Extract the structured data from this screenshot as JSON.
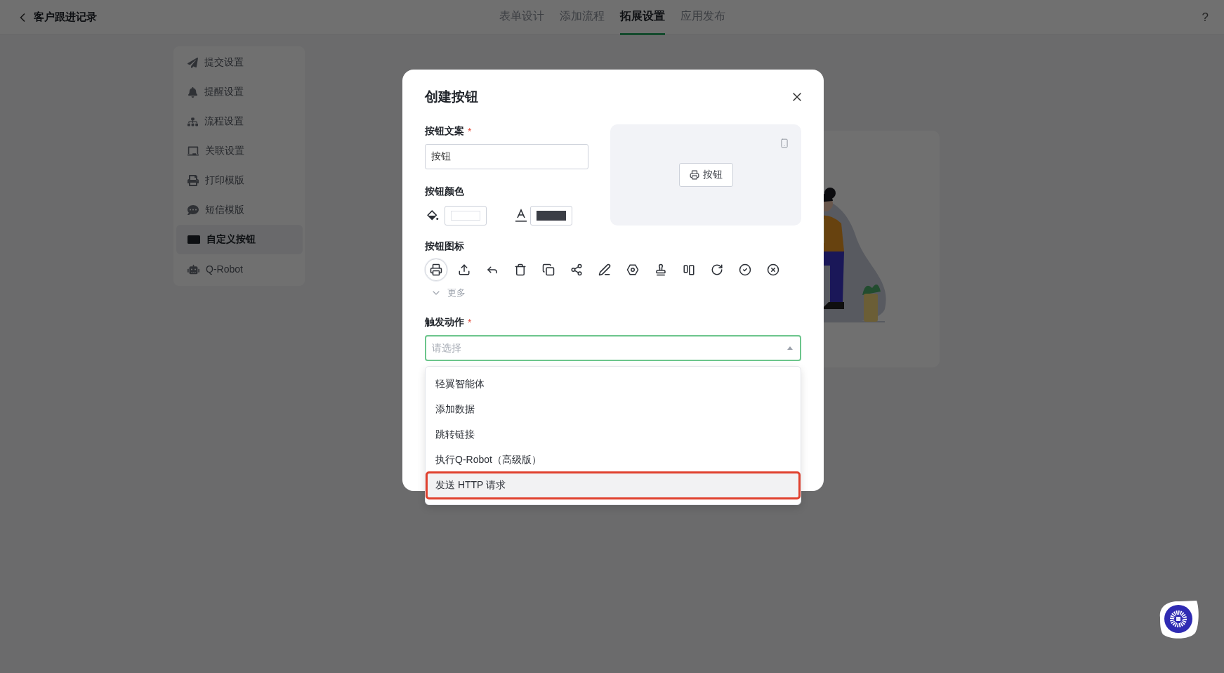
{
  "header": {
    "title": "客户跟进记录",
    "help": "?",
    "tabs": [
      {
        "label": "表单设计",
        "selected": false
      },
      {
        "label": "添加流程",
        "selected": false
      },
      {
        "label": "拓展设置",
        "selected": true
      },
      {
        "label": "应用发布",
        "selected": false
      }
    ]
  },
  "sidebar": {
    "items": [
      {
        "label": "提交设置",
        "selected": false
      },
      {
        "label": "提醒设置",
        "selected": false
      },
      {
        "label": "流程设置",
        "selected": false
      },
      {
        "label": "关联设置",
        "selected": false
      },
      {
        "label": "打印模版",
        "selected": false
      },
      {
        "label": "短信模版",
        "selected": false
      },
      {
        "label": "自定义按钮",
        "selected": true
      },
      {
        "label": "Q-Robot",
        "selected": false
      }
    ]
  },
  "dialog": {
    "title": "创建按钮",
    "text_field": {
      "label": "按钮文案",
      "required_mark": "*",
      "value": "按钮"
    },
    "color_field": {
      "label": "按钮颜色",
      "swatches": [
        {
          "kind": "fill",
          "color": "#ffffff"
        },
        {
          "kind": "text",
          "color": "#3a3d45"
        }
      ]
    },
    "preview": {
      "button_label": "按钮"
    },
    "icon_field": {
      "label": "按钮图标",
      "more": "更多",
      "options": [
        {
          "selected": true
        },
        {
          "selected": false
        },
        {
          "selected": false
        },
        {
          "selected": false
        },
        {
          "selected": false
        },
        {
          "selected": false
        },
        {
          "selected": false
        },
        {
          "selected": false
        },
        {
          "selected": false
        },
        {
          "selected": false
        },
        {
          "selected": false
        },
        {
          "selected": false
        },
        {
          "selected": false
        }
      ]
    },
    "action_field": {
      "label": "触发动作",
      "required_mark": "*",
      "placeholder": "请选择",
      "expanded": true,
      "options": [
        {
          "label": "轻翼智能体",
          "highlighted": false
        },
        {
          "label": "添加数据",
          "highlighted": false
        },
        {
          "label": "跳转链接",
          "highlighted": false
        },
        {
          "label": "执行Q-Robot（高级版）",
          "highlighted": false
        },
        {
          "label": "发送 HTTP 请求",
          "highlighted": true
        }
      ]
    }
  }
}
